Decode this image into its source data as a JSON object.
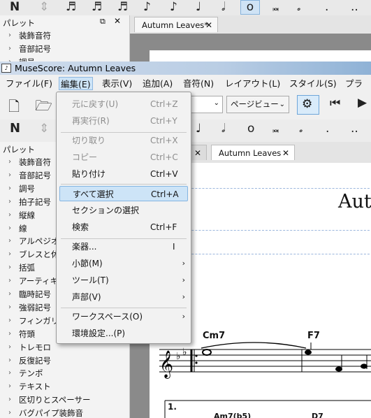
{
  "bg": {
    "palette_title": "パレット",
    "palette_items": [
      "装飾音符",
      "音部記号",
      "調号"
    ],
    "tab_label": "Autumn Leaves*"
  },
  "window": {
    "title": "MuseScore: Autumn Leaves"
  },
  "menubar": [
    "ファイル(F)",
    "編集(E)",
    "表示(V)",
    "追加(A)",
    "音符(N)",
    "レイアウト(L)",
    "スタイル(S)",
    "プラグ"
  ],
  "toolbar": {
    "view_mode": "ページビュー"
  },
  "edit_menu": [
    {
      "label": "元に戻す(U)",
      "shortcut": "Ctrl+Z",
      "disabled": true
    },
    {
      "label": "再実行(R)",
      "shortcut": "Ctrl+Y",
      "disabled": true
    },
    {
      "label": "切り取り",
      "shortcut": "Ctrl+X",
      "disabled": true
    },
    {
      "label": "コピー",
      "shortcut": "Ctrl+C",
      "disabled": true
    },
    {
      "label": "貼り付け",
      "shortcut": "Ctrl+V",
      "disabled": false
    },
    {
      "label": "すべて選択",
      "shortcut": "Ctrl+A",
      "disabled": false,
      "highlighted": true
    },
    {
      "label": "セクションの選択",
      "shortcut": "",
      "disabled": false
    },
    {
      "label": "検索",
      "shortcut": "Ctrl+F",
      "disabled": false
    },
    {
      "label": "楽器...",
      "shortcut": "I",
      "disabled": false
    },
    {
      "label": "小節(M)",
      "submenu": true
    },
    {
      "label": "ツール(T)",
      "submenu": true
    },
    {
      "label": "声部(V)",
      "submenu": true
    },
    {
      "label": "ワークスペース(O)",
      "submenu": true
    },
    {
      "label": "環境設定...(P)",
      "shortcut": ""
    }
  ],
  "palette": {
    "title": "パレット",
    "items": [
      "装飾音符",
      "音部記号",
      "調号",
      "拍子記号",
      "縦線",
      "線",
      "アルペジオと",
      "ブレスと休止",
      "括弧",
      "アーティキュ",
      "臨時記号",
      "強弱記号",
      "フィンガリング",
      "符頭",
      "トレモロ",
      "反復記号",
      "テンポ",
      "テキスト",
      "区切りとスペーサー",
      "バグパイプ装飾音"
    ]
  },
  "tabs": {
    "active": "Autumn Leaves"
  },
  "score": {
    "title": "Aut",
    "chords": [
      "Cm7",
      "F7"
    ],
    "volta": "1.",
    "chords2": [
      "Am7(b5)",
      "D7"
    ]
  }
}
